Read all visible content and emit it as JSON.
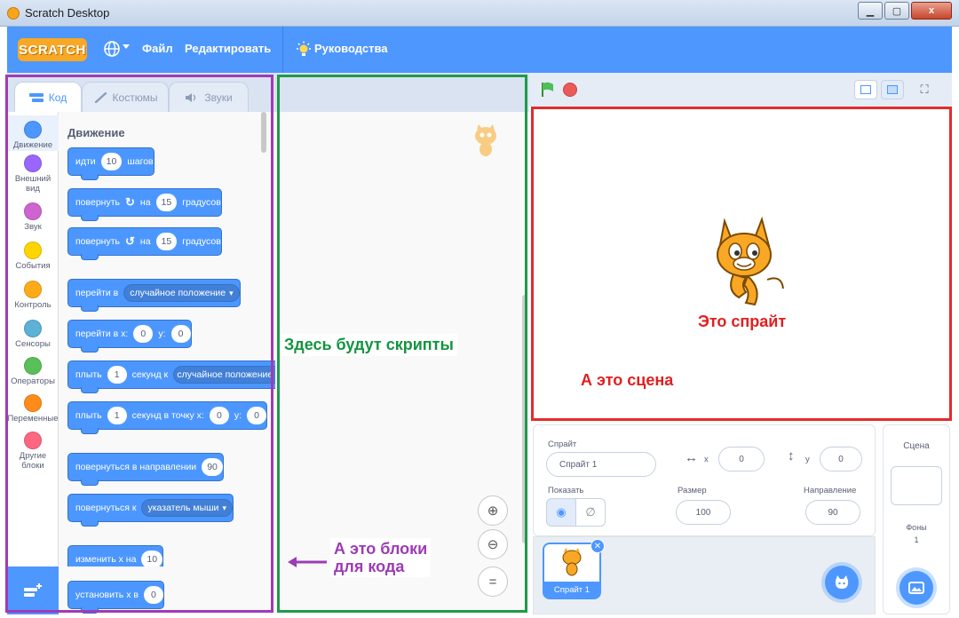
{
  "window": {
    "title": "Scratch Desktop",
    "close_glyph": "x"
  },
  "menubar": {
    "logo": "SCRATCH",
    "file": "Файл",
    "edit": "Редактировать",
    "tutorials": "Руководства"
  },
  "tabs": {
    "code": "Код",
    "costumes": "Костюмы",
    "sounds": "Звуки"
  },
  "categories": [
    {
      "label": "Движение",
      "color": "#4c97ff"
    },
    {
      "label": "Внешний вид",
      "color": "#9966ff"
    },
    {
      "label": "Звук",
      "color": "#cf63cf"
    },
    {
      "label": "События",
      "color": "#ffd500"
    },
    {
      "label": "Контроль",
      "color": "#ffab19"
    },
    {
      "label": "Сенсоры",
      "color": "#5cb1d6"
    },
    {
      "label": "Операторы",
      "color": "#59c059"
    },
    {
      "label": "Переменные",
      "color": "#ff8c1a"
    },
    {
      "label": "Другие блоки",
      "color": "#ff6680"
    }
  ],
  "palette": {
    "heading": "Движение",
    "blocks": {
      "move": {
        "a": "идти",
        "v": "10",
        "b": "шагов"
      },
      "turn_right": {
        "a": "повернуть",
        "b": "на",
        "v": "15",
        "c": "градусов"
      },
      "turn_left": {
        "a": "повернуть",
        "b": "на",
        "v": "15",
        "c": "градусов"
      },
      "goto": {
        "a": "перейти в",
        "v": "случайное положение"
      },
      "goto_xy": {
        "a": "перейти в x:",
        "x": "0",
        "b": "y:",
        "y": "0"
      },
      "glide_to": {
        "a": "плыть",
        "v": "1",
        "b": "секунд к",
        "d": "случайное положение"
      },
      "glide_xy": {
        "a": "плыть",
        "v": "1",
        "b": "секунд в точку x:",
        "x": "0",
        "c": "y:",
        "y": "0"
      },
      "point_dir": {
        "a": "повернуться в направлении",
        "v": "90"
      },
      "point_towards": {
        "a": "повернуться к",
        "v": "указатель мыши"
      },
      "change_x": {
        "a": "изменить х на",
        "v": "10"
      },
      "set_x": {
        "a": "установить х в",
        "v": "0"
      }
    }
  },
  "annotations": {
    "scripts": "Здесь будут скрипты",
    "blocks_line1": "А это блоки",
    "blocks_line2": "для кода",
    "sprite": "Это спрайт",
    "stage": "А это сцена"
  },
  "sprite_info": {
    "sprite_label": "Спрайт",
    "sprite_name": "Спрайт 1",
    "x_label": "x",
    "x_value": "0",
    "y_label": "y",
    "y_value": "0",
    "show_label": "Показать",
    "size_label": "Размер",
    "size_value": "100",
    "direction_label": "Направление",
    "direction_value": "90"
  },
  "sprite_list": {
    "tile_name": "Спрайт 1"
  },
  "stage_pane": {
    "header": "Сцена",
    "backdrops_label": "Фоны",
    "backdrops_count": "1"
  },
  "colors": {
    "accent": "#4d97ff",
    "motion": "#4c97ff",
    "frame_purple": "#a13ab5",
    "frame_green": "#1e9a4a",
    "frame_red": "#e32c2c"
  }
}
